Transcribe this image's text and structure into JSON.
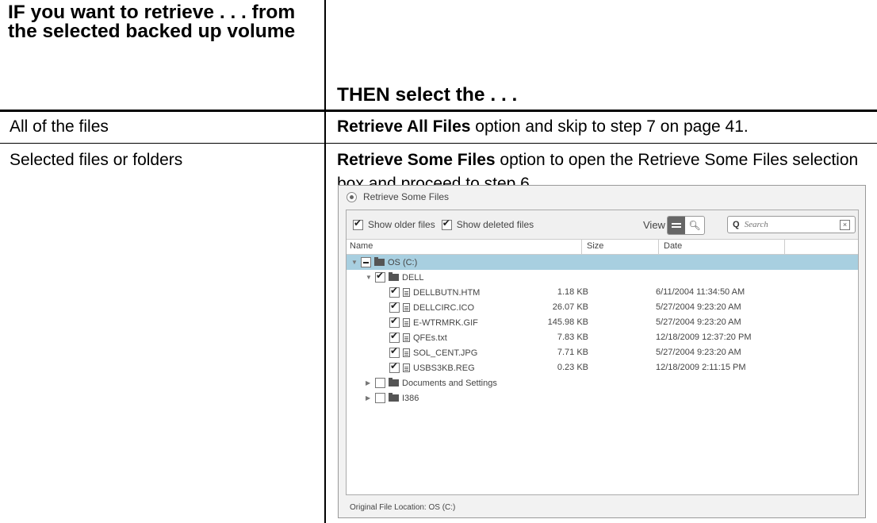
{
  "table": {
    "header_left": "IF you want to retrieve . . . from the selected backed up volume",
    "header_right": "THEN select the . . .",
    "rows": [
      {
        "left": "All of the files",
        "right_bold": "Retrieve All Files",
        "right_rest": " option and skip to step 7 on page 41."
      },
      {
        "left": "Selected files or folders",
        "right_bold": "Retrieve Some Files",
        "right_rest": " option to open the Retrieve Some Files selection box and proceed to step 6."
      }
    ]
  },
  "window": {
    "title": "Retrieve Some Files",
    "show_older": "Show older files",
    "show_deleted": "Show deleted files",
    "view_label": "View",
    "search_placeholder": "Search",
    "columns": {
      "name": "Name",
      "size": "Size",
      "date": "Date"
    },
    "tree": [
      {
        "name": "OS (C:)",
        "type": "folder",
        "level": 0,
        "expanded": true,
        "check": "partial",
        "size": "",
        "date": "",
        "selected": true
      },
      {
        "name": "DELL",
        "type": "folder",
        "level": 1,
        "expanded": true,
        "check": "checked",
        "size": "",
        "date": ""
      },
      {
        "name": "DELLBUTN.HTM",
        "type": "file",
        "level": 2,
        "check": "checked",
        "size": "1.18 KB",
        "date": "6/11/2004 11:34:50 AM"
      },
      {
        "name": "DELLCIRC.ICO",
        "type": "file",
        "level": 2,
        "check": "checked",
        "size": "26.07 KB",
        "date": "5/27/2004 9:23:20 AM"
      },
      {
        "name": "E-WTRMRK.GIF",
        "type": "file",
        "level": 2,
        "check": "checked",
        "size": "145.98 KB",
        "date": "5/27/2004 9:23:20 AM"
      },
      {
        "name": "QFEs.txt",
        "type": "file",
        "level": 2,
        "check": "checked",
        "size": "7.83 KB",
        "date": "12/18/2009 12:37:20 PM"
      },
      {
        "name": "SOL_CENT.JPG",
        "type": "file",
        "level": 2,
        "check": "checked",
        "size": "7.71 KB",
        "date": "5/27/2004 9:23:20 AM"
      },
      {
        "name": "USBS3KB.REG",
        "type": "file",
        "level": 2,
        "check": "checked",
        "size": "0.23 KB",
        "date": "12/18/2009 2:11:15 PM"
      },
      {
        "name": "Documents and Settings",
        "type": "folder",
        "level": 1,
        "expanded": false,
        "check": "unchecked",
        "size": "",
        "date": ""
      },
      {
        "name": "I386",
        "type": "folder",
        "level": 1,
        "expanded": false,
        "check": "unchecked",
        "size": "",
        "date": ""
      }
    ],
    "status": "Original File Location:   OS (C:)"
  }
}
